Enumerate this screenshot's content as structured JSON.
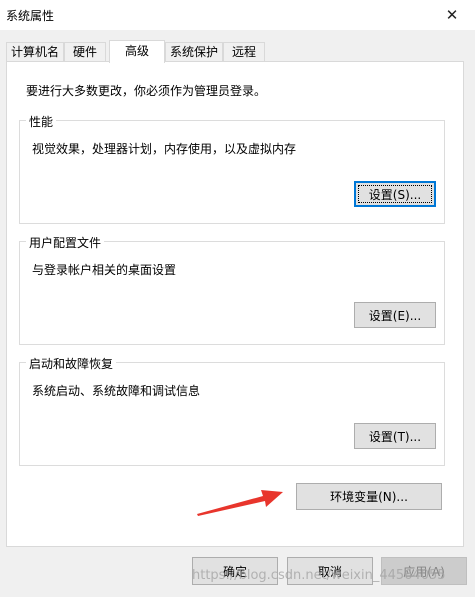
{
  "window": {
    "title": "系统属性",
    "close_glyph": "✕"
  },
  "tabs": [
    {
      "label": "计算机名"
    },
    {
      "label": "硬件"
    },
    {
      "label": "高级",
      "active": true
    },
    {
      "label": "系统保护"
    },
    {
      "label": "远程"
    }
  ],
  "notice": "要进行大多数更改，你必须作为管理员登录。",
  "groups": {
    "performance": {
      "title": "性能",
      "desc": "视觉效果，处理器计划，内存使用，以及虚拟内存",
      "button": "设置(S)..."
    },
    "profiles": {
      "title": "用户配置文件",
      "desc": "与登录帐户相关的桌面设置",
      "button": "设置(E)..."
    },
    "startup": {
      "title": "启动和故障恢复",
      "desc": "系统启动、系统故障和调试信息",
      "button": "设置(T)..."
    }
  },
  "env_button": "环境变量(N)...",
  "footer": {
    "ok": "确定",
    "cancel": "取消",
    "apply": "应用(A)"
  },
  "watermark": "https://blog.csdn.net/weixin_44564055",
  "colors": {
    "focus_border": "#0078d7",
    "arrow": "#e8352c"
  }
}
